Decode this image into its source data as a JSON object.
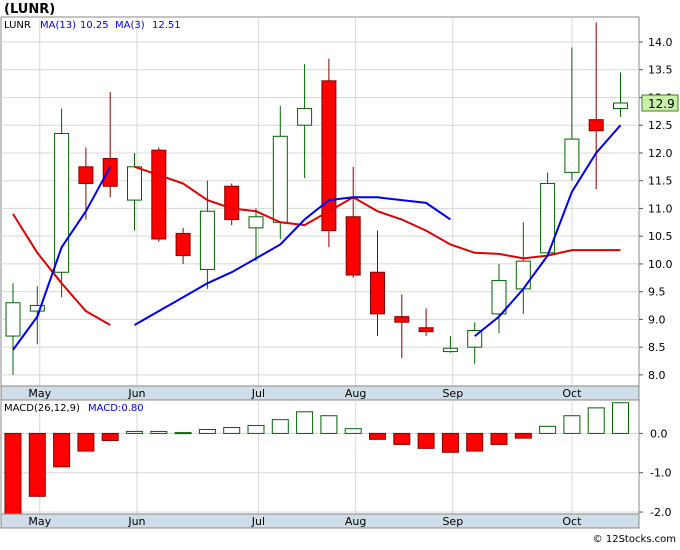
{
  "chart_data": {
    "type": "candlestick",
    "ticker": "(LUNR)",
    "price_panel": {
      "legend": [
        {
          "label": "LUNR",
          "color": "#000000"
        },
        {
          "label": "MA(13)",
          "color": "#0000ee"
        },
        {
          "label": "10.25",
          "color": "#0000ee"
        },
        {
          "label": "MA(3)",
          "color": "#0000ee"
        },
        {
          "label": "12.51",
          "color": "#0000ee"
        }
      ],
      "ylim": [
        7.8,
        14.45
      ],
      "y_ticks": [
        8.0,
        8.5,
        9.0,
        9.5,
        10.0,
        10.5,
        11.0,
        11.5,
        12.0,
        12.5,
        13.0,
        13.5,
        14.0
      ],
      "y_tick_labels": [
        "8.0",
        "8.5",
        "9.0",
        "9.5",
        "10.0",
        "10.5",
        "11.0",
        "11.5",
        "12.0",
        "12.5",
        "13.0",
        "13.5",
        "14.0"
      ],
      "last_price_label": "12.9",
      "last_price": 12.9,
      "candles": [
        {
          "o": 8.7,
          "h": 9.65,
          "l": 8.0,
          "c": 9.3
        },
        {
          "o": 9.15,
          "h": 9.6,
          "l": 8.55,
          "c": 9.25
        },
        {
          "o": 9.85,
          "h": 12.8,
          "l": 9.4,
          "c": 12.35
        },
        {
          "o": 11.75,
          "h": 12.1,
          "l": 10.8,
          "c": 11.45
        },
        {
          "o": 11.9,
          "h": 13.1,
          "l": 11.2,
          "c": 11.4
        },
        {
          "o": 11.15,
          "h": 12.0,
          "l": 10.6,
          "c": 11.75
        },
        {
          "o": 12.05,
          "h": 12.1,
          "l": 10.4,
          "c": 10.45
        },
        {
          "o": 10.55,
          "h": 10.65,
          "l": 10.0,
          "c": 10.15
        },
        {
          "o": 9.9,
          "h": 11.5,
          "l": 9.55,
          "c": 10.95
        },
        {
          "o": 11.4,
          "h": 11.45,
          "l": 10.7,
          "c": 10.8
        },
        {
          "o": 10.65,
          "h": 11.0,
          "l": 10.05,
          "c": 10.85
        },
        {
          "o": 10.75,
          "h": 12.85,
          "l": 10.45,
          "c": 12.3
        },
        {
          "o": 12.5,
          "h": 13.6,
          "l": 11.55,
          "c": 12.8
        },
        {
          "o": 13.3,
          "h": 13.7,
          "l": 10.3,
          "c": 10.6
        },
        {
          "o": 10.85,
          "h": 11.75,
          "l": 9.75,
          "c": 9.8
        },
        {
          "o": 9.85,
          "h": 10.6,
          "l": 8.7,
          "c": 9.1
        },
        {
          "o": 9.05,
          "h": 9.45,
          "l": 8.3,
          "c": 8.95
        },
        {
          "o": 8.85,
          "h": 9.2,
          "l": 8.7,
          "c": 8.78
        },
        {
          "o": 8.42,
          "h": 8.7,
          "l": 8.4,
          "c": 8.48
        },
        {
          "o": 8.5,
          "h": 8.95,
          "l": 8.2,
          "c": 8.8
        },
        {
          "o": 9.1,
          "h": 10.0,
          "l": 8.75,
          "c": 9.7
        },
        {
          "o": 9.55,
          "h": 10.75,
          "l": 9.1,
          "c": 10.05
        },
        {
          "o": 10.2,
          "h": 11.65,
          "l": 10.15,
          "c": 11.45
        },
        {
          "o": 11.65,
          "h": 13.9,
          "l": 11.5,
          "c": 12.25
        },
        {
          "o": 12.6,
          "h": 14.35,
          "l": 11.35,
          "c": 12.4
        },
        {
          "o": 12.8,
          "h": 13.45,
          "l": 12.65,
          "c": 12.9
        }
      ],
      "series": [
        {
          "name": "MA(13)",
          "color": "#e00000",
          "values": [
            10.9,
            10.2,
            9.65,
            9.15,
            8.9,
            11.75,
            11.6,
            11.45,
            11.15,
            11.0,
            10.95,
            10.75,
            10.7,
            10.95,
            11.2,
            10.95,
            10.8,
            10.6,
            10.35,
            10.2,
            10.18,
            10.1,
            10.15,
            10.25,
            10.25,
            10.25
          ]
        },
        {
          "name": "MA(3)",
          "color": "#0000ee",
          "values": [
            8.45,
            9.05,
            10.3,
            10.95,
            11.75,
            8.9,
            9.15,
            9.4,
            9.65,
            9.85,
            10.1,
            10.35,
            10.8,
            11.15,
            11.2,
            11.2,
            11.15,
            11.1,
            10.8,
            8.7,
            9.05,
            9.55,
            10.15,
            11.3,
            12.0,
            12.5
          ]
        }
      ]
    },
    "macd_panel": {
      "legend": [
        {
          "label": "MACD(26,12,9)",
          "color": "#000000"
        },
        {
          "label": "MACD:0.80",
          "color": "#0000ee"
        }
      ],
      "ylim": [
        -2.05,
        0.85
      ],
      "y_ticks": [
        0.0,
        -1.0,
        -2.0
      ],
      "y_tick_labels": [
        "0.0",
        "-1.0",
        "-2.0"
      ],
      "bars": [
        -2.05,
        -1.6,
        -0.85,
        -0.45,
        -0.18,
        0.05,
        0.05,
        0.02,
        0.1,
        0.15,
        0.2,
        0.35,
        0.55,
        0.45,
        0.12,
        -0.15,
        -0.28,
        -0.38,
        -0.48,
        -0.45,
        -0.28,
        -0.12,
        0.18,
        0.45,
        0.65,
        0.78
      ]
    },
    "x_tick_labels": [
      {
        "label": "May",
        "index": 1.1
      },
      {
        "label": "Jun",
        "index": 5.1
      },
      {
        "label": "Jul",
        "index": 10.1
      },
      {
        "label": "Aug",
        "index": 14.1
      },
      {
        "label": "Sep",
        "index": 18.1
      },
      {
        "label": "Oct",
        "index": 23.0
      }
    ],
    "watermark": "© 12Stocks.com",
    "grid": true,
    "colors": {
      "up": "#ffffff",
      "up_border": "#006400",
      "down": "#ff0000",
      "down_border": "#880000",
      "axis_bg": "#d0dce8",
      "last_price_box": "#c8f0a8"
    }
  }
}
